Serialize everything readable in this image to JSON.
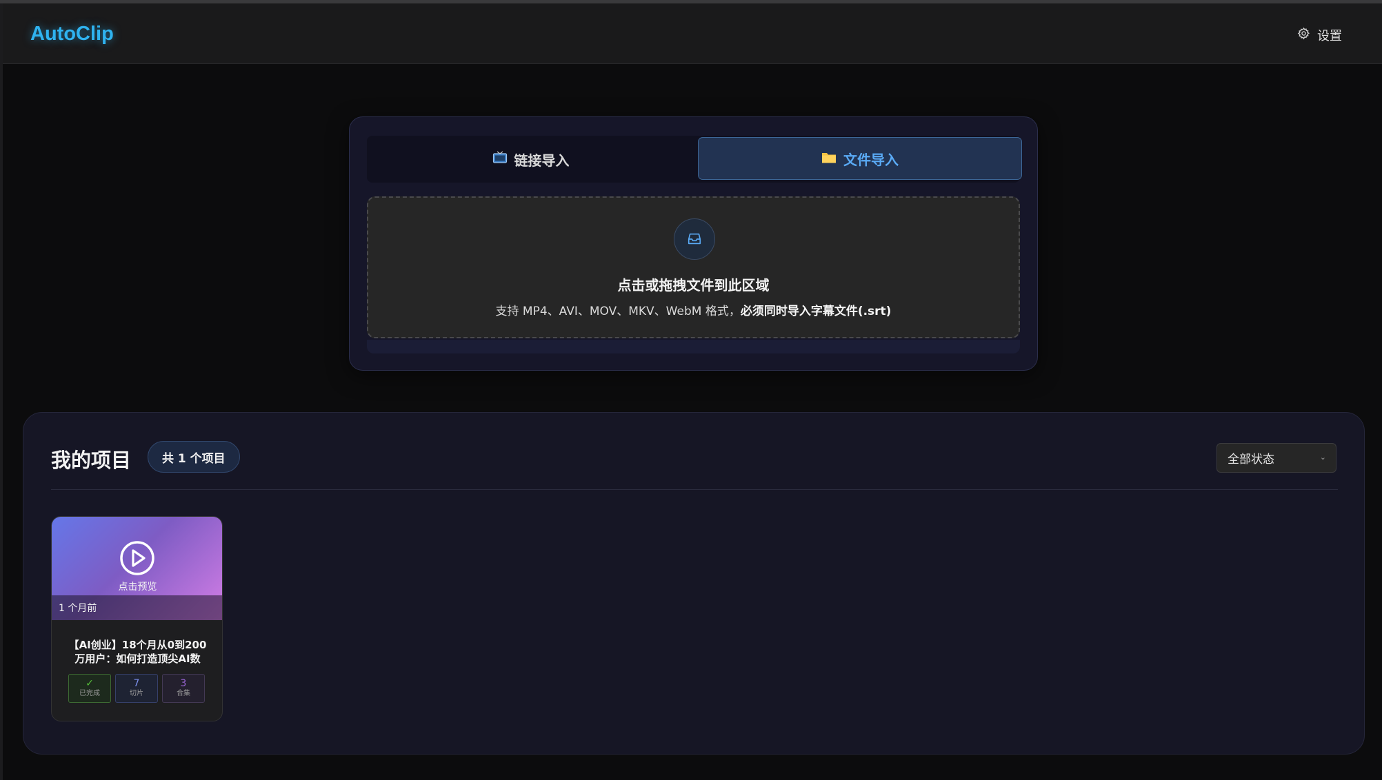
{
  "app": {
    "logo": "AutoClip",
    "settings_label": "设置"
  },
  "import": {
    "tabs": [
      {
        "label": "链接导入",
        "icon": "tv-icon",
        "active": false
      },
      {
        "label": "文件导入",
        "icon": "folder-icon",
        "active": true
      }
    ],
    "dropzone": {
      "title": "点击或拖拽文件到此区域",
      "hint_prefix": "支持 MP4、AVI、MOV、MKV、WebM 格式，",
      "hint_bold": "必须同时导入字幕文件(.srt)"
    }
  },
  "projects": {
    "title": "我的项目",
    "count_label": "共 1 个项目",
    "filter": {
      "selected": "全部状态"
    },
    "items": [
      {
        "preview_label": "点击预览",
        "time_ago": "1 个月前",
        "name": "【AI创业】18个月从0到200万用户：如何打造顶尖AI数",
        "stats": {
          "status": {
            "value": "✓",
            "label": "已完成"
          },
          "clips": {
            "value": "7",
            "label": "切片"
          },
          "collections": {
            "value": "3",
            "label": "合集"
          }
        }
      }
    ]
  },
  "colors": {
    "accent": "#2fb3f0",
    "active_tab": "#5aaaf5",
    "done": "#58c43a"
  }
}
